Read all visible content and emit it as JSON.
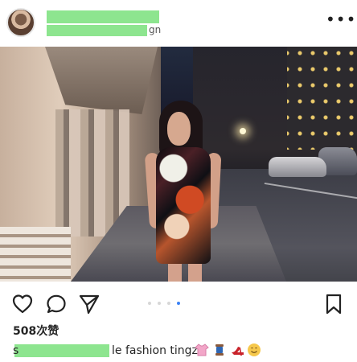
{
  "post": {
    "header": {
      "location_suffix": "gn",
      "menu_glyph": "•••"
    },
    "likes": "508次赞",
    "caption": {
      "prefix": "s",
      "text": "le fashion tingz"
    },
    "carousel": {
      "count": 4,
      "active_index": 3
    },
    "icons": [
      "heart-icon",
      "comment-icon",
      "share-icon",
      "bookmark-icon",
      "shirt-icon",
      "thread-icon",
      "heel-icon",
      "smile-icon"
    ],
    "colors": {
      "active_dot": "#3b82f6",
      "redaction": "#8de58f"
    }
  }
}
